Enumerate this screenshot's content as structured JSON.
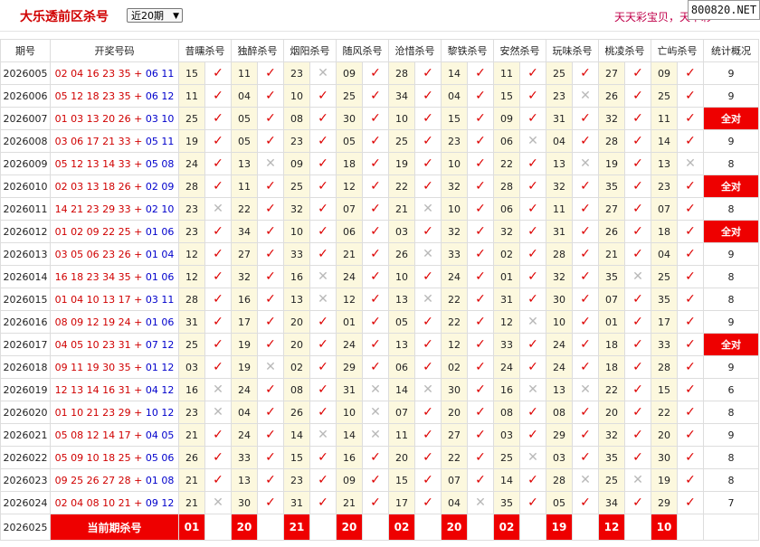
{
  "header": {
    "title": "大乐透前区杀号",
    "range_select": "近20期",
    "right_text": "天天彩宝贝，天下彩",
    "watermark": "800820.NET"
  },
  "columns": [
    "期号",
    "开奖号码",
    "昔曛杀号",
    "独醉杀号",
    "烟阳杀号",
    "随风杀号",
    "沧惜杀号",
    "黎铁杀号",
    "安然杀号",
    "玩味杀号",
    "桃凌杀号",
    "亡屿杀号",
    "统计概况"
  ],
  "marks": {
    "ok": "✓",
    "no": "✕"
  },
  "rows": [
    {
      "issue": "2026005",
      "front": "02 04 16 23 35",
      "back": "06 11",
      "kills": [
        [
          "15",
          1
        ],
        [
          "11",
          1
        ],
        [
          "23",
          0
        ],
        [
          "09",
          1
        ],
        [
          "28",
          1
        ],
        [
          "14",
          1
        ],
        [
          "11",
          1
        ],
        [
          "25",
          1
        ],
        [
          "27",
          1
        ],
        [
          "09",
          1
        ]
      ],
      "stat": "9"
    },
    {
      "issue": "2026006",
      "front": "05 12 18 23 35",
      "back": "06 12",
      "kills": [
        [
          "11",
          1
        ],
        [
          "04",
          1
        ],
        [
          "10",
          1
        ],
        [
          "25",
          1
        ],
        [
          "34",
          1
        ],
        [
          "04",
          1
        ],
        [
          "15",
          1
        ],
        [
          "23",
          0
        ],
        [
          "26",
          1
        ],
        [
          "25",
          1
        ]
      ],
      "stat": "9"
    },
    {
      "issue": "2026007",
      "front": "01 03 13 20 26",
      "back": "03 10",
      "kills": [
        [
          "25",
          1
        ],
        [
          "05",
          1
        ],
        [
          "08",
          1
        ],
        [
          "30",
          1
        ],
        [
          "10",
          1
        ],
        [
          "15",
          1
        ],
        [
          "09",
          1
        ],
        [
          "31",
          1
        ],
        [
          "32",
          1
        ],
        [
          "11",
          1
        ]
      ],
      "stat": "全对"
    },
    {
      "issue": "2026008",
      "front": "03 06 17 21 33",
      "back": "05 11",
      "kills": [
        [
          "19",
          1
        ],
        [
          "05",
          1
        ],
        [
          "23",
          1
        ],
        [
          "05",
          1
        ],
        [
          "25",
          1
        ],
        [
          "23",
          1
        ],
        [
          "06",
          0
        ],
        [
          "04",
          1
        ],
        [
          "28",
          1
        ],
        [
          "14",
          1
        ]
      ],
      "stat": "9"
    },
    {
      "issue": "2026009",
      "front": "05 12 13 14 33",
      "back": "05 08",
      "kills": [
        [
          "24",
          1
        ],
        [
          "13",
          0
        ],
        [
          "09",
          1
        ],
        [
          "18",
          1
        ],
        [
          "19",
          1
        ],
        [
          "10",
          1
        ],
        [
          "22",
          1
        ],
        [
          "13",
          0
        ],
        [
          "19",
          1
        ],
        [
          "13",
          0
        ]
      ],
      "stat": "8"
    },
    {
      "issue": "2026010",
      "front": "02 03 13 18 26",
      "back": "02 09",
      "kills": [
        [
          "28",
          1
        ],
        [
          "11",
          1
        ],
        [
          "25",
          1
        ],
        [
          "12",
          1
        ],
        [
          "22",
          1
        ],
        [
          "32",
          1
        ],
        [
          "28",
          1
        ],
        [
          "32",
          1
        ],
        [
          "35",
          1
        ],
        [
          "23",
          1
        ]
      ],
      "stat": "全对"
    },
    {
      "issue": "2026011",
      "front": "14 21 23 29 33",
      "back": "02 10",
      "kills": [
        [
          "23",
          0
        ],
        [
          "22",
          1
        ],
        [
          "32",
          1
        ],
        [
          "07",
          1
        ],
        [
          "21",
          0
        ],
        [
          "10",
          1
        ],
        [
          "06",
          1
        ],
        [
          "11",
          1
        ],
        [
          "27",
          1
        ],
        [
          "07",
          1
        ]
      ],
      "stat": "8"
    },
    {
      "issue": "2026012",
      "front": "01 02 09 22 25",
      "back": "01 06",
      "kills": [
        [
          "23",
          1
        ],
        [
          "34",
          1
        ],
        [
          "10",
          1
        ],
        [
          "06",
          1
        ],
        [
          "03",
          1
        ],
        [
          "32",
          1
        ],
        [
          "32",
          1
        ],
        [
          "31",
          1
        ],
        [
          "26",
          1
        ],
        [
          "18",
          1
        ]
      ],
      "stat": "全对"
    },
    {
      "issue": "2026013",
      "front": "03 05 06 23 26",
      "back": "01 04",
      "kills": [
        [
          "12",
          1
        ],
        [
          "27",
          1
        ],
        [
          "33",
          1
        ],
        [
          "21",
          1
        ],
        [
          "26",
          0
        ],
        [
          "33",
          1
        ],
        [
          "02",
          1
        ],
        [
          "28",
          1
        ],
        [
          "21",
          1
        ],
        [
          "04",
          1
        ]
      ],
      "stat": "9"
    },
    {
      "issue": "2026014",
      "front": "16 18 23 34 35",
      "back": "01 06",
      "kills": [
        [
          "12",
          1
        ],
        [
          "32",
          1
        ],
        [
          "16",
          0
        ],
        [
          "24",
          1
        ],
        [
          "10",
          1
        ],
        [
          "24",
          1
        ],
        [
          "01",
          1
        ],
        [
          "32",
          1
        ],
        [
          "35",
          0
        ],
        [
          "25",
          1
        ]
      ],
      "stat": "8"
    },
    {
      "issue": "2026015",
      "front": "01 04 10 13 17",
      "back": "03 11",
      "kills": [
        [
          "28",
          1
        ],
        [
          "16",
          1
        ],
        [
          "13",
          0
        ],
        [
          "12",
          1
        ],
        [
          "13",
          0
        ],
        [
          "22",
          1
        ],
        [
          "31",
          1
        ],
        [
          "30",
          1
        ],
        [
          "07",
          1
        ],
        [
          "35",
          1
        ]
      ],
      "stat": "8"
    },
    {
      "issue": "2026016",
      "front": "08 09 12 19 24",
      "back": "01 06",
      "kills": [
        [
          "31",
          1
        ],
        [
          "17",
          1
        ],
        [
          "20",
          1
        ],
        [
          "01",
          1
        ],
        [
          "05",
          1
        ],
        [
          "22",
          1
        ],
        [
          "12",
          0
        ],
        [
          "10",
          1
        ],
        [
          "01",
          1
        ],
        [
          "17",
          1
        ]
      ],
      "stat": "9"
    },
    {
      "issue": "2026017",
      "front": "04 05 10 23 31",
      "back": "07 12",
      "kills": [
        [
          "25",
          1
        ],
        [
          "19",
          1
        ],
        [
          "20",
          1
        ],
        [
          "24",
          1
        ],
        [
          "13",
          1
        ],
        [
          "12",
          1
        ],
        [
          "33",
          1
        ],
        [
          "24",
          1
        ],
        [
          "18",
          1
        ],
        [
          "33",
          1
        ]
      ],
      "stat": "全对"
    },
    {
      "issue": "2026018",
      "front": "09 11 19 30 35",
      "back": "01 12",
      "kills": [
        [
          "03",
          1
        ],
        [
          "19",
          0
        ],
        [
          "02",
          1
        ],
        [
          "29",
          1
        ],
        [
          "06",
          1
        ],
        [
          "02",
          1
        ],
        [
          "24",
          1
        ],
        [
          "24",
          1
        ],
        [
          "18",
          1
        ],
        [
          "28",
          1
        ]
      ],
      "stat": "9"
    },
    {
      "issue": "2026019",
      "front": "12 13 14 16 31",
      "back": "04 12",
      "kills": [
        [
          "16",
          0
        ],
        [
          "24",
          1
        ],
        [
          "08",
          1
        ],
        [
          "31",
          0
        ],
        [
          "14",
          0
        ],
        [
          "30",
          1
        ],
        [
          "16",
          0
        ],
        [
          "13",
          0
        ],
        [
          "22",
          1
        ],
        [
          "15",
          1
        ]
      ],
      "stat": "6"
    },
    {
      "issue": "2026020",
      "front": "01 10 21 23 29",
      "back": "10 12",
      "kills": [
        [
          "23",
          0
        ],
        [
          "04",
          1
        ],
        [
          "26",
          1
        ],
        [
          "10",
          0
        ],
        [
          "07",
          1
        ],
        [
          "20",
          1
        ],
        [
          "08",
          1
        ],
        [
          "08",
          1
        ],
        [
          "20",
          1
        ],
        [
          "22",
          1
        ]
      ],
      "stat": "8"
    },
    {
      "issue": "2026021",
      "front": "05 08 12 14 17",
      "back": "04 05",
      "kills": [
        [
          "21",
          1
        ],
        [
          "24",
          1
        ],
        [
          "14",
          0
        ],
        [
          "14",
          0
        ],
        [
          "11",
          1
        ],
        [
          "27",
          1
        ],
        [
          "03",
          1
        ],
        [
          "29",
          1
        ],
        [
          "32",
          1
        ],
        [
          "20",
          1
        ]
      ],
      "stat": "9"
    },
    {
      "issue": "2026022",
      "front": "05 09 10 18 25",
      "back": "05 06",
      "kills": [
        [
          "26",
          1
        ],
        [
          "33",
          1
        ],
        [
          "15",
          1
        ],
        [
          "16",
          1
        ],
        [
          "20",
          1
        ],
        [
          "22",
          1
        ],
        [
          "25",
          0
        ],
        [
          "03",
          1
        ],
        [
          "35",
          1
        ],
        [
          "30",
          1
        ]
      ],
      "stat": "8"
    },
    {
      "issue": "2026023",
      "front": "09 25 26 27 28",
      "back": "01 08",
      "kills": [
        [
          "21",
          1
        ],
        [
          "13",
          1
        ],
        [
          "23",
          1
        ],
        [
          "09",
          1
        ],
        [
          "15",
          1
        ],
        [
          "07",
          1
        ],
        [
          "14",
          1
        ],
        [
          "28",
          0
        ],
        [
          "25",
          0
        ],
        [
          "19",
          1
        ]
      ],
      "stat": "8"
    },
    {
      "issue": "2026024",
      "front": "02 04 08 10 21",
      "back": "09 12",
      "kills": [
        [
          "21",
          0
        ],
        [
          "30",
          1
        ],
        [
          "31",
          1
        ],
        [
          "21",
          1
        ],
        [
          "17",
          1
        ],
        [
          "04",
          0
        ],
        [
          "35",
          1
        ],
        [
          "05",
          1
        ],
        [
          "34",
          1
        ],
        [
          "29",
          1
        ]
      ],
      "stat": "7"
    }
  ],
  "current": {
    "issue": "2026025",
    "label": "当前期杀号",
    "kills": [
      "01",
      "20",
      "21",
      "20",
      "02",
      "20",
      "02",
      "19",
      "12",
      "10"
    ]
  }
}
